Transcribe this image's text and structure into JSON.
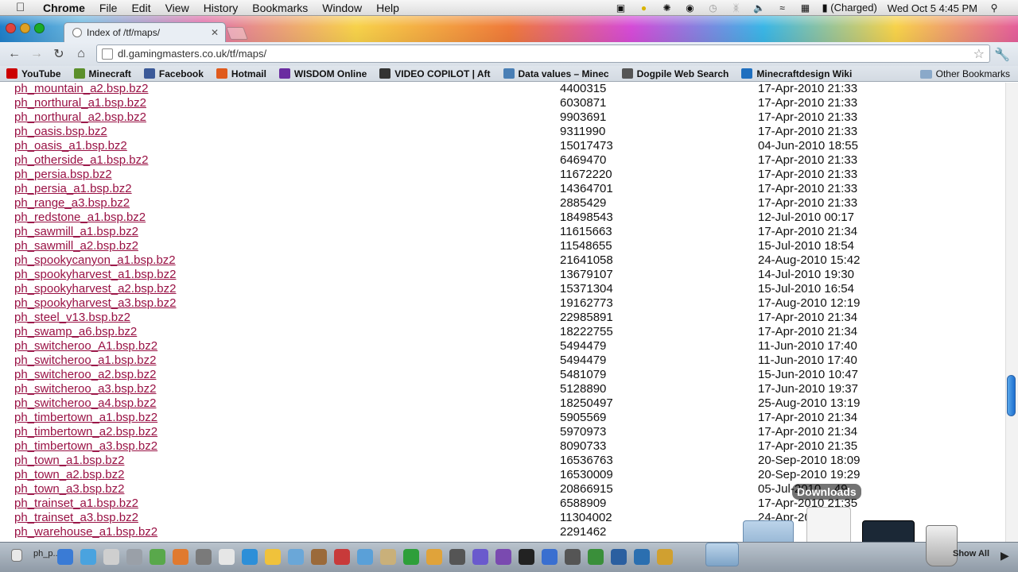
{
  "menubar": {
    "app_name": "Chrome",
    "menus": [
      "File",
      "Edit",
      "View",
      "History",
      "Bookmarks",
      "Window",
      "Help"
    ],
    "battery_status": "(Charged)",
    "clock": "Wed Oct 5  4:45 PM"
  },
  "tab": {
    "title": "Index of /tf/maps/"
  },
  "toolbar": {
    "url": "dl.gamingmasters.co.uk/tf/maps/"
  },
  "bookmarks": {
    "items": [
      {
        "label": "YouTube",
        "icon": "youtube-icon",
        "color": "#cc0000"
      },
      {
        "label": "Minecraft",
        "icon": "minecraft-icon",
        "color": "#5b8f2b"
      },
      {
        "label": "Facebook",
        "icon": "facebook-icon",
        "color": "#3b5998"
      },
      {
        "label": "Hotmail",
        "icon": "hotmail-icon",
        "color": "#e05a1c"
      },
      {
        "label": "WISDOM Online",
        "icon": "wisdom-icon",
        "color": "#6a2ca0"
      },
      {
        "label": "VIDEO COPILOT | Aft",
        "icon": "videocopilot-icon",
        "color": "#333333"
      },
      {
        "label": "Data values – Minec",
        "icon": "cube-icon",
        "color": "#4a7fb5"
      },
      {
        "label": "Dogpile Web Search",
        "icon": "dogpile-icon",
        "color": "#555555"
      },
      {
        "label": "Minecraftdesign Wiki",
        "icon": "wiki-icon",
        "color": "#1f6fbf"
      }
    ],
    "other_label": "Other Bookmarks"
  },
  "listing": {
    "rows": [
      {
        "name": "ph_mountain_a2.bsp.bz2",
        "size": "4400315",
        "date": "17-Apr-2010 21:33"
      },
      {
        "name": "ph_northural_a1.bsp.bz2",
        "size": "6030871",
        "date": "17-Apr-2010 21:33"
      },
      {
        "name": "ph_northural_a2.bsp.bz2",
        "size": "9903691",
        "date": "17-Apr-2010 21:33"
      },
      {
        "name": "ph_oasis.bsp.bz2",
        "size": "9311990",
        "date": "17-Apr-2010 21:33"
      },
      {
        "name": "ph_oasis_a1.bsp.bz2",
        "size": "15017473",
        "date": "04-Jun-2010 18:55"
      },
      {
        "name": "ph_otherside_a1.bsp.bz2",
        "size": "6469470",
        "date": "17-Apr-2010 21:33"
      },
      {
        "name": "ph_persia.bsp.bz2",
        "size": "11672220",
        "date": "17-Apr-2010 21:33"
      },
      {
        "name": "ph_persia_a1.bsp.bz2",
        "size": "14364701",
        "date": "17-Apr-2010 21:33"
      },
      {
        "name": "ph_range_a3.bsp.bz2",
        "size": "2885429",
        "date": "17-Apr-2010 21:33"
      },
      {
        "name": "ph_redstone_a1.bsp.bz2",
        "size": "18498543",
        "date": "12-Jul-2010 00:17"
      },
      {
        "name": "ph_sawmill_a1.bsp.bz2",
        "size": "11615663",
        "date": "17-Apr-2010 21:34"
      },
      {
        "name": "ph_sawmill_a2.bsp.bz2",
        "size": "11548655",
        "date": "15-Jul-2010 18:54"
      },
      {
        "name": "ph_spookycanyon_a1.bsp.bz2",
        "size": "21641058",
        "date": "24-Aug-2010 15:42"
      },
      {
        "name": "ph_spookyharvest_a1.bsp.bz2",
        "size": "13679107",
        "date": "14-Jul-2010 19:30"
      },
      {
        "name": "ph_spookyharvest_a2.bsp.bz2",
        "size": "15371304",
        "date": "15-Jul-2010 16:54"
      },
      {
        "name": "ph_spookyharvest_a3.bsp.bz2",
        "size": "19162773",
        "date": "17-Aug-2010 12:19"
      },
      {
        "name": "ph_steel_v13.bsp.bz2",
        "size": "22985891",
        "date": "17-Apr-2010 21:34"
      },
      {
        "name": "ph_swamp_a6.bsp.bz2",
        "size": "18222755",
        "date": "17-Apr-2010 21:34"
      },
      {
        "name": "ph_switcheroo_A1.bsp.bz2",
        "size": "5494479",
        "date": "11-Jun-2010 17:40"
      },
      {
        "name": "ph_switcheroo_a1.bsp.bz2",
        "size": "5494479",
        "date": "11-Jun-2010 17:40"
      },
      {
        "name": "ph_switcheroo_a2.bsp.bz2",
        "size": "5481079",
        "date": "15-Jun-2010 10:47"
      },
      {
        "name": "ph_switcheroo_a3.bsp.bz2",
        "size": "5128890",
        "date": "17-Jun-2010 19:37"
      },
      {
        "name": "ph_switcheroo_a4.bsp.bz2",
        "size": "18250497",
        "date": "25-Aug-2010 13:19"
      },
      {
        "name": "ph_timbertown_a1.bsp.bz2",
        "size": "5905569",
        "date": "17-Apr-2010 21:34"
      },
      {
        "name": "ph_timbertown_a2.bsp.bz2",
        "size": "5970973",
        "date": "17-Apr-2010 21:34"
      },
      {
        "name": "ph_timbertown_a3.bsp.bz2",
        "size": "8090733",
        "date": "17-Apr-2010 21:35"
      },
      {
        "name": "ph_town_a1.bsp.bz2",
        "size": "16536763",
        "date": "20-Sep-2010 18:09"
      },
      {
        "name": "ph_town_a2.bsp.bz2",
        "size": "16530009",
        "date": "20-Sep-2010 19:29"
      },
      {
        "name": "ph_town_a3.bsp.bz2",
        "size": "20866915",
        "date": "05-Jul-2010 ...49"
      },
      {
        "name": "ph_trainset_a1.bsp.bz2",
        "size": "6588909",
        "date": "17-Apr-2010 21:35"
      },
      {
        "name": "ph_trainset_a3.bsp.bz2",
        "size": "11304002",
        "date": "24-Apr-2010 10:5"
      },
      {
        "name": "ph_warehouse_a1.bsp.bz2",
        "size": "2291462",
        "date": ""
      }
    ]
  },
  "downloads_stack": {
    "label": "Downloads"
  },
  "dock": {
    "minimized_window_label": "ph_p...",
    "show_all_label": "Show All"
  }
}
